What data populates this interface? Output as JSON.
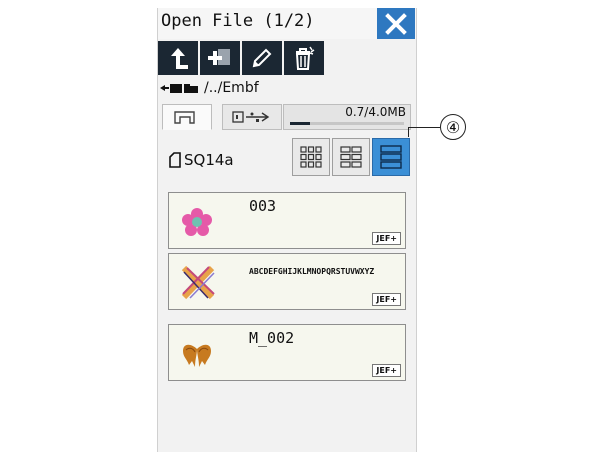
{
  "window": {
    "title": "Open File (1/2)"
  },
  "toolbar": {
    "buttons": [
      {
        "icon": "up-folder-icon"
      },
      {
        "icon": "new-folder-icon"
      },
      {
        "icon": "rename-pencil-icon"
      },
      {
        "icon": "delete-icon"
      }
    ]
  },
  "path": {
    "text": "/../Embf"
  },
  "tabs": [
    {
      "icon": "machine-memory-icon",
      "active": true
    },
    {
      "icon": "usb-icon",
      "active": false
    }
  ],
  "memory": {
    "label": "0.7/4.0MB",
    "used_fraction": 0.175
  },
  "folder": {
    "name": "SQ14a"
  },
  "view_modes": [
    "grid-large-icon",
    "grid-medium-icon",
    "list-icon"
  ],
  "files": [
    {
      "name": "003",
      "format": "JEF+",
      "thumbnail": "flower-icon"
    },
    {
      "name": "ABCDEFGHIJKLMNOPQRSTUVWXYZ",
      "format": "JEF+",
      "thumbnail": "cross-stitch-icon"
    },
    {
      "name": "M_002",
      "format": "JEF+",
      "thumbnail": "bow-icon"
    }
  ],
  "callout": {
    "label": "④"
  },
  "colors": {
    "accent": "#2e78c0",
    "toolbar": "#1b2733",
    "file_bg": "#f6f7ee"
  }
}
